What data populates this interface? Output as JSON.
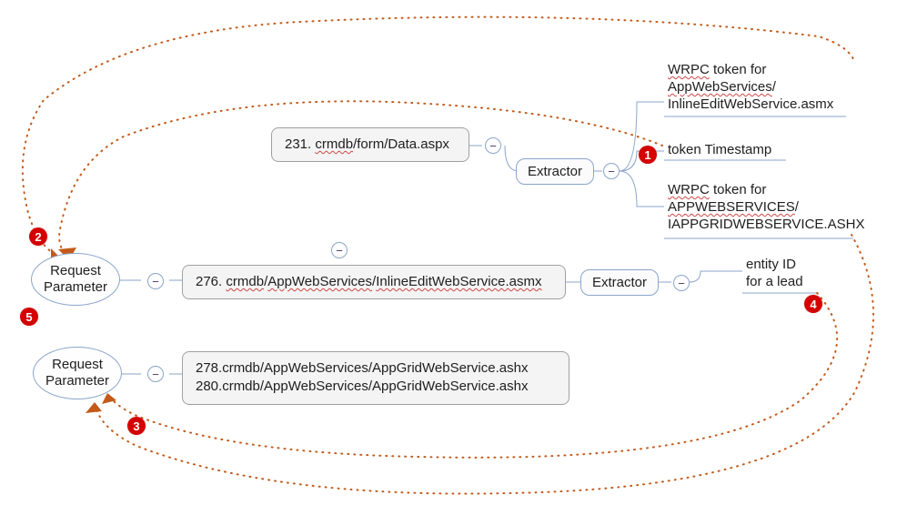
{
  "nodes": {
    "box231": {
      "prefix": "231. ",
      "label_w": "crmdb",
      "label_r": "/form/Data.aspx"
    },
    "box276": {
      "prefix": "276. ",
      "label_w1": "crmdb",
      "label_r1": "/",
      "label_w2": "AppWebServices",
      "label_r2": "/",
      "label_w3": "InlineEditWebService.asmx"
    },
    "box278": {
      "line1": "278.crmdb/AppWebServices/AppGridWebService.ashx",
      "line2": "280.crmdb/AppWebServices/AppGridWebService.ashx"
    },
    "req_param_276": "Request\nParameter",
    "req_param_278": "Request\nParameter",
    "extractor_231": "Extractor",
    "extractor_276": "Extractor"
  },
  "extracted": {
    "token_inline_1a": "WRPC",
    "token_inline_1b": " token for",
    "token_inline_2": "AppWebServices",
    "token_inline_2b": "/",
    "token_inline_3": "InlineEditWebService.asmx",
    "token_timestamp": "token Timestamp",
    "token_grid_1a": "WRPC",
    "token_grid_1b": " token for",
    "token_grid_2": "APPWEBSERVICES",
    "token_grid_2b": "/",
    "token_grid_3": "IAPPGRIDWEBSERVICE.ASHX",
    "entity_id_1": "entity ID",
    "entity_id_2": "for a lead"
  },
  "badges": {
    "b1": "1",
    "b2": "2",
    "b3": "3",
    "b4": "4",
    "b5": "5"
  },
  "glyphs": {
    "minus": "−"
  }
}
